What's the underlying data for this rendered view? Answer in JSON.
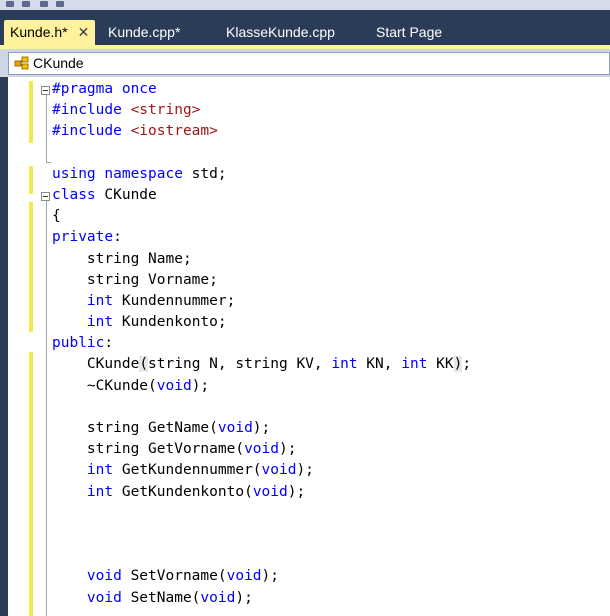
{
  "tabs": [
    {
      "label": "Kunde.h*",
      "active": true,
      "close": "✕"
    },
    {
      "label": "Kunde.cpp*",
      "active": false
    },
    {
      "label": "KlasseKunde.cpp",
      "active": false
    },
    {
      "label": "Start Page",
      "active": false
    }
  ],
  "navbar": {
    "class_name": "CKunde",
    "icon": "class-icon"
  },
  "colors": {
    "frame": "#2b3c59",
    "active_tab": "#fff29d",
    "keyword": "#0000ff",
    "string": "#a31515",
    "change_bar": "#f5e84e"
  },
  "code_lines": [
    [
      {
        "t": "#pragma once",
        "c": "kw"
      }
    ],
    [
      {
        "t": "#include ",
        "c": "kw"
      },
      {
        "t": "<string>",
        "c": "str"
      }
    ],
    [
      {
        "t": "#include ",
        "c": "kw"
      },
      {
        "t": "<iostream>",
        "c": "str"
      }
    ],
    [],
    [
      {
        "t": "using namespace",
        "c": "kw"
      },
      {
        "t": " std;"
      }
    ],
    [
      {
        "t": "class",
        "c": "kw"
      },
      {
        "t": " CKunde"
      }
    ],
    [
      {
        "t": "{"
      }
    ],
    [
      {
        "t": "private",
        "c": "kw"
      },
      {
        "t": ":"
      }
    ],
    [
      {
        "t": "    string Name;"
      }
    ],
    [
      {
        "t": "    string Vorname;"
      }
    ],
    [
      {
        "t": "    "
      },
      {
        "t": "int",
        "c": "kw"
      },
      {
        "t": " Kundennummer;"
      }
    ],
    [
      {
        "t": "    "
      },
      {
        "t": "int",
        "c": "kw"
      },
      {
        "t": " Kundenkonto;"
      }
    ],
    [
      {
        "t": "public",
        "c": "kw"
      },
      {
        "t": ":"
      }
    ],
    [
      {
        "t": "    CKunde"
      },
      {
        "t": "(",
        "c": "hl"
      },
      {
        "t": "string N, string KV, "
      },
      {
        "t": "int",
        "c": "kw"
      },
      {
        "t": " KN, "
      },
      {
        "t": "int",
        "c": "kw"
      },
      {
        "t": " KK"
      },
      {
        "t": ")",
        "c": "hl"
      },
      {
        "t": ";"
      }
    ],
    [
      {
        "t": "    ~CKunde("
      },
      {
        "t": "void",
        "c": "kw"
      },
      {
        "t": ");"
      }
    ],
    [],
    [
      {
        "t": "    string GetName("
      },
      {
        "t": "void",
        "c": "kw"
      },
      {
        "t": ");"
      }
    ],
    [
      {
        "t": "    string GetVorname("
      },
      {
        "t": "void",
        "c": "kw"
      },
      {
        "t": ");"
      }
    ],
    [
      {
        "t": "    "
      },
      {
        "t": "int",
        "c": "kw"
      },
      {
        "t": " GetKundennummer("
      },
      {
        "t": "void",
        "c": "kw"
      },
      {
        "t": ");"
      }
    ],
    [
      {
        "t": "    "
      },
      {
        "t": "int",
        "c": "kw"
      },
      {
        "t": " GetKundenkonto("
      },
      {
        "t": "void",
        "c": "kw"
      },
      {
        "t": ");"
      }
    ],
    [],
    [],
    [],
    [
      {
        "t": "    "
      },
      {
        "t": "void",
        "c": "kw"
      },
      {
        "t": " SetVorname("
      },
      {
        "t": "void",
        "c": "kw"
      },
      {
        "t": ");"
      }
    ],
    [
      {
        "t": "    "
      },
      {
        "t": "void",
        "c": "kw"
      },
      {
        "t": " SetName("
      },
      {
        "t": "void",
        "c": "kw"
      },
      {
        "t": ");"
      }
    ]
  ]
}
